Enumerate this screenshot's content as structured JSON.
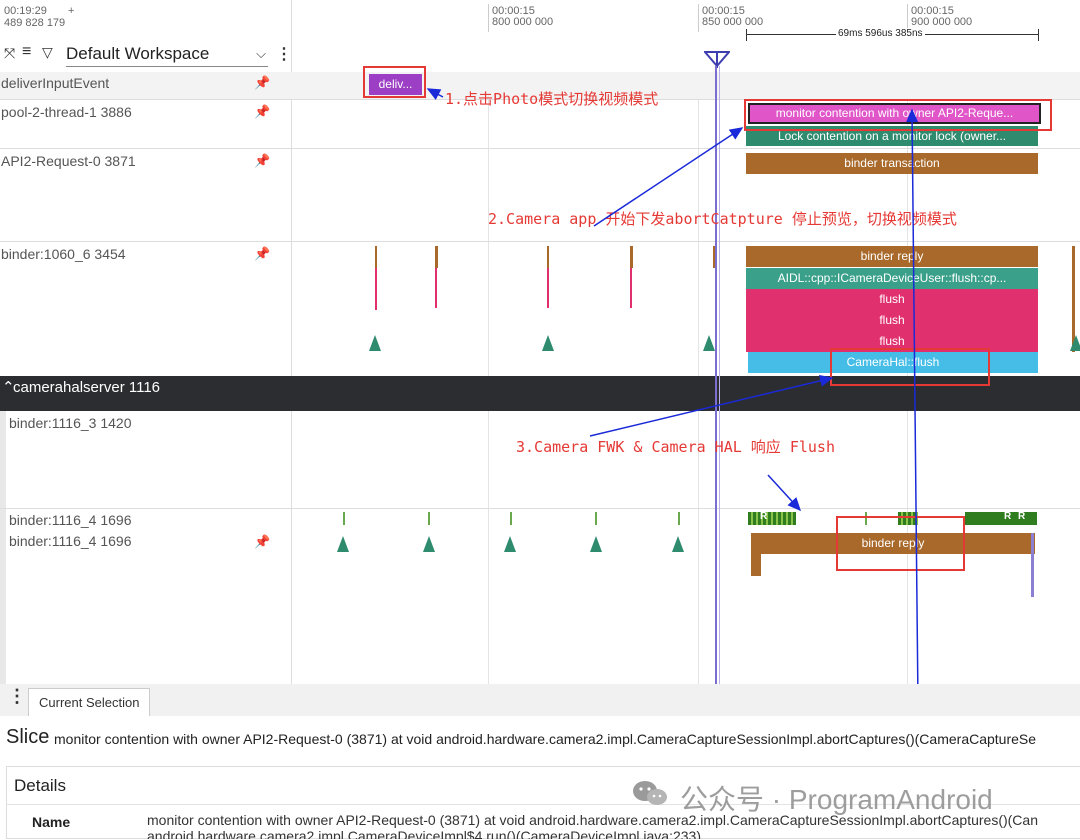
{
  "header": {
    "time_offset": "00:19:29",
    "time_offset_ns": "489 828 179",
    "plus": "+",
    "workspace": "Default Workspace",
    "ticks": [
      {
        "label": "00:00:15",
        "sub": "800 000 000"
      },
      {
        "label": "00:00:15",
        "sub": "850 000 000"
      },
      {
        "label": "00:00:15",
        "sub": "900 000 000"
      }
    ],
    "range_label": "69ms 596us 385ns"
  },
  "tracks": {
    "deliver": "deliverInputEvent",
    "pool": "pool-2-thread-1 3886",
    "api2": "API2-Request-0 3871",
    "binder1060": "binder:1060_6 3454",
    "camerahal": "camerahalserver 1116",
    "binder1116_3": "binder:1116_3 1420",
    "binder1116_4a": "binder:1116_4 1696",
    "binder1116_4b": "binder:1116_4 1696"
  },
  "slices": {
    "deliv": "deliv...",
    "monitor": "monitor contention with owner API2-Reque...",
    "lock": "Lock contention on a monitor lock (owner...",
    "binder_txn": "binder transaction",
    "binder_reply": "binder reply",
    "aidl": "AIDL::cpp::ICameraDeviceUser::flush::cp...",
    "flush1": "flush",
    "flush2": "flush",
    "flush3": "flush",
    "camerahal_flush": "CameraHal::flush",
    "binder_reply2": "binder reply",
    "r1": "R",
    "r2": "R",
    "r3": "R"
  },
  "annotations": {
    "a1": "1.点击Photo模式切换视频模式",
    "a2": "2.Camera app 开始下发abortCatpture 停止预览，切换视频模式",
    "a3": "3.Camera FWK & Camera HAL 响应 Flush"
  },
  "bottom": {
    "tab": "Current Selection",
    "slice_word": "Slice",
    "slice_desc": "monitor contention with owner API2-Request-0 (3871) at void android.hardware.camera2.impl.CameraCaptureSessionImpl.abortCaptures()(CameraCaptureSe",
    "details": "Details",
    "name_label": "Name",
    "name_value_1": "monitor contention with owner API2-Request-0 (3871) at void android.hardware.camera2.impl.CameraCaptureSessionImpl.abortCaptures()(Can",
    "name_value_2": "android.hardware.camera2.impl.CameraDeviceImpl$4.run()(CameraDeviceImpl.java:233)"
  },
  "watermark": "公众号 · ProgramAndroid",
  "colors": {
    "purple": "#9c3fc4",
    "pink_monitor": "#e056c8",
    "green_lock": "#2e8b6e",
    "brown": "#a8692a",
    "teal": "#3aa08a",
    "flush_pink": "#e0306e",
    "cyan": "#45bde6",
    "dark_band": "#2b2d30",
    "annotation_red": "#e53935",
    "arrow_blue": "#1a2ad8"
  }
}
